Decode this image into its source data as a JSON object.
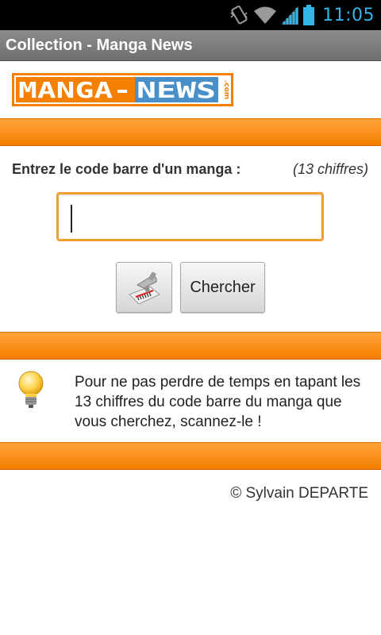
{
  "status_bar": {
    "time": "11:05"
  },
  "title_bar": {
    "title": "Collection - Manga News"
  },
  "logo": {
    "text": "MANGA-NEWS",
    "suffix": ".com"
  },
  "form": {
    "label": "Entrez le code barre d'un manga :",
    "hint": "(13 chiffres)",
    "input_value": "",
    "scan_icon": "barcode-scanner-icon",
    "search_label": "Chercher"
  },
  "info": {
    "icon": "lightbulb-icon",
    "text": "Pour ne pas perdre de temps en tapant les 13 chiffres du code barre du manga que vous cherchez, scannez-le !"
  },
  "footer": {
    "copyright": "© Sylvain DEPARTE"
  },
  "colors": {
    "orange": "#f57f00",
    "accent": "#33b5e5",
    "logo_blue": "#4a90c8"
  }
}
